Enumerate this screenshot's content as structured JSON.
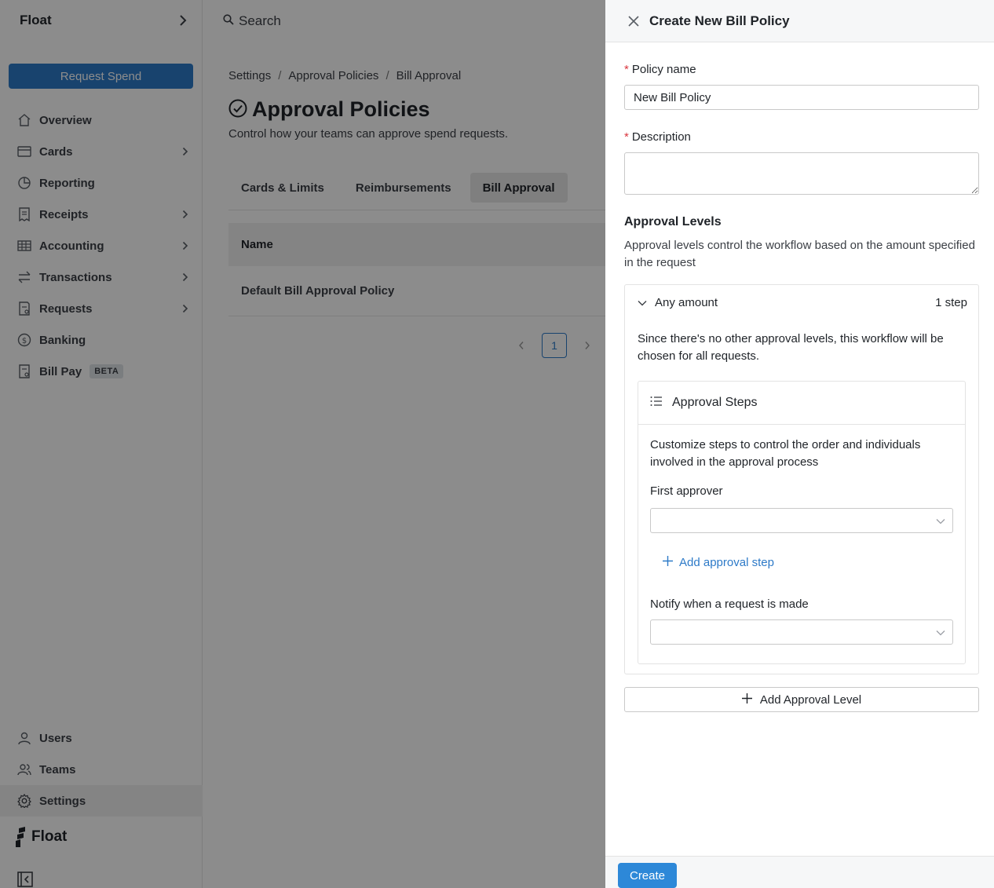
{
  "sidebar": {
    "title": "Float",
    "request_button": "Request Spend",
    "items": [
      {
        "label": "Overview",
        "icon": "home-icon"
      },
      {
        "label": "Cards",
        "icon": "card-icon"
      },
      {
        "label": "Reporting",
        "icon": "pie-chart-icon"
      },
      {
        "label": "Receipts",
        "icon": "receipt-icon"
      },
      {
        "label": "Accounting",
        "icon": "grid-icon"
      },
      {
        "label": "Transactions",
        "icon": "transfer-icon"
      },
      {
        "label": "Requests",
        "icon": "request-icon"
      },
      {
        "label": "Banking",
        "icon": "dollar-circle-icon"
      },
      {
        "label": "Bill Pay",
        "icon": "bill-icon",
        "badge": "BETA"
      }
    ],
    "bottom_items": [
      {
        "label": "Users",
        "icon": "user-icon"
      },
      {
        "label": "Teams",
        "icon": "team-icon"
      },
      {
        "label": "Settings",
        "icon": "gear-icon"
      }
    ],
    "logo_text": "Float"
  },
  "main": {
    "search_label": "Search",
    "breadcrumb": [
      "Settings",
      "Approval Policies",
      "Bill Approval"
    ],
    "breadcrumb_sep": "/",
    "page_title": "Approval Policies",
    "page_subtitle": "Control how your teams can approve spend requests.",
    "tabs": [
      "Cards & Limits",
      "Reimbursements",
      "Bill Approval"
    ],
    "active_tab": "Bill Approval",
    "table": {
      "header": "Name",
      "rows": [
        "Default Bill Approval Policy"
      ]
    },
    "pagination": {
      "current": "1"
    }
  },
  "drawer": {
    "title": "Create New Bill Policy",
    "policy_name_label": "Policy name",
    "policy_name_value": "New Bill Policy",
    "description_label": "Description",
    "description_value": "",
    "required_mark": "*",
    "approval_levels_title": "Approval Levels",
    "approval_levels_desc": "Approval levels control the workflow based on the amount specified in the request",
    "level": {
      "label": "Any amount",
      "steps": "1 step",
      "desc": "Since there's no other approval levels, this workflow will be chosen for all requests.",
      "steps_card": {
        "title": "Approval Steps",
        "desc": "Customize steps to control the order and individuals involved in the approval process",
        "first_approver_label": "First approver",
        "add_step": "Add approval step",
        "notify_label": "Notify when a request is made"
      }
    },
    "add_level": "Add Approval Level",
    "create_button": "Create"
  },
  "colors": {
    "accent": "#2d7ac8",
    "overlay": "rgba(0,0,0,0.45)",
    "required": "#d9363e"
  }
}
